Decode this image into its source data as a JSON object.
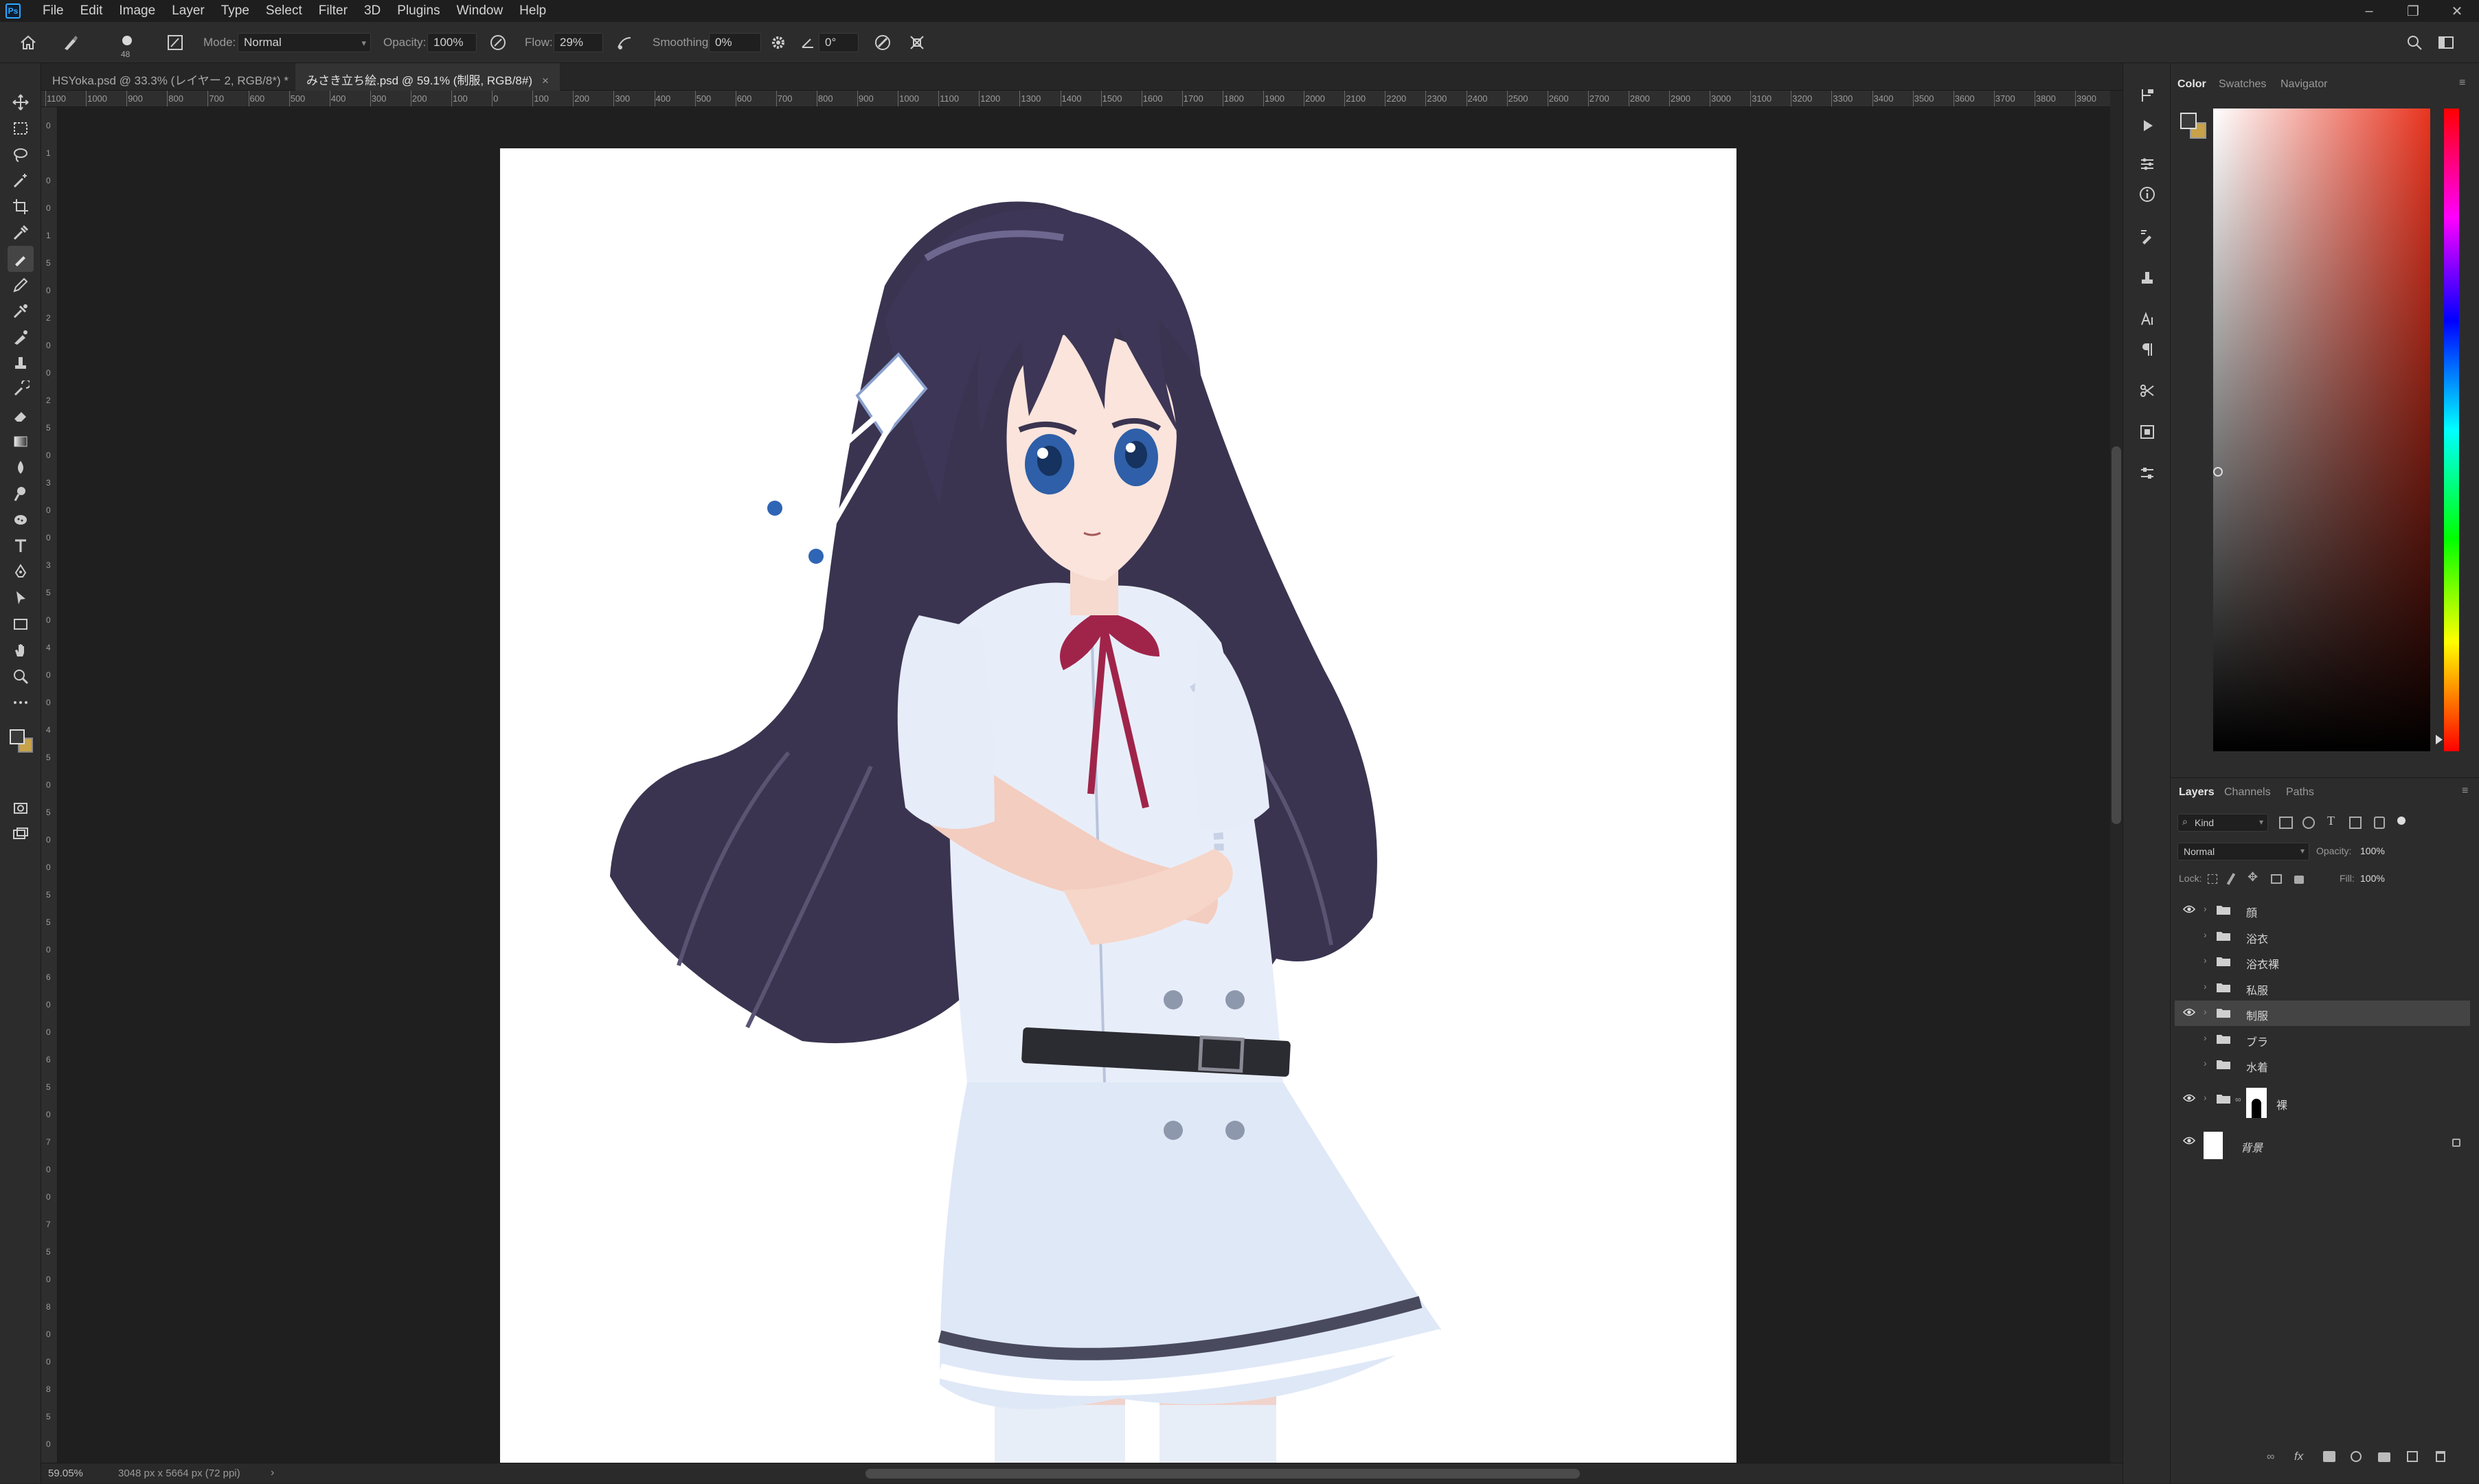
{
  "app": {
    "logo": "Ps"
  },
  "menu": [
    "File",
    "Edit",
    "Image",
    "Layer",
    "Type",
    "Select",
    "Filter",
    "3D",
    "Plugins",
    "Window",
    "Help"
  ],
  "window_controls": [
    "–",
    "❐",
    "✕"
  ],
  "options_bar": {
    "brush_size": "48",
    "mode_label": "Mode:",
    "mode_value": "Normal",
    "opacity_label": "Opacity:",
    "opacity_value": "100%",
    "flow_label": "Flow:",
    "flow_value": "29%",
    "smoothing_label": "Smoothing:",
    "smoothing_value": "0%",
    "angle_value": "0°"
  },
  "tabs": [
    {
      "label": "HSYoka.psd @ 33.3% (レイヤー 2, RGB/8*) *",
      "active": false
    },
    {
      "label": "みさき立ち絵.psd @ 59.1% (制服, RGB/8#)",
      "active": true
    }
  ],
  "ruler_h": [
    "1100",
    "1000",
    "900",
    "800",
    "700",
    "600",
    "500",
    "400",
    "300",
    "200",
    "100",
    "0",
    "100",
    "200",
    "300",
    "400",
    "500",
    "600",
    "700",
    "800",
    "900",
    "1000",
    "1100",
    "1200",
    "1300",
    "1400",
    "1500",
    "1600",
    "1700",
    "1800",
    "1900",
    "2000",
    "2100",
    "2200",
    "2300",
    "2400",
    "2500",
    "2600",
    "2700",
    "2800",
    "2900",
    "3000",
    "3100",
    "3200",
    "3300",
    "3400",
    "3500",
    "3600",
    "3700",
    "3800",
    "3900"
  ],
  "ruler_v": [
    "0",
    "1",
    "0",
    "0",
    "1",
    "5",
    "0",
    "2",
    "0",
    "0",
    "2",
    "5",
    "0",
    "3",
    "0",
    "0",
    "3",
    "5",
    "0",
    "4",
    "0",
    "0",
    "4",
    "5",
    "0",
    "5",
    "0",
    "0",
    "5",
    "5",
    "0",
    "6",
    "0",
    "0",
    "6",
    "5",
    "0",
    "7",
    "0",
    "0",
    "7",
    "5",
    "0",
    "8",
    "0",
    "0",
    "8",
    "5",
    "0"
  ],
  "status": {
    "zoom": "59.05%",
    "doc_info": "3048 px x 5664 px (72 ppi)",
    "arrow": "›"
  },
  "color_panel": {
    "tabs": [
      "Color",
      "Swatches",
      "Navigator"
    ],
    "active_tab": "Color",
    "foreground": "#3a3a3a",
    "background": "#c8a24a"
  },
  "layers_panel": {
    "tabs": [
      "Layers",
      "Channels",
      "Paths"
    ],
    "filter_label": "Kind",
    "blend_mode": "Normal",
    "opacity_label": "Opacity:",
    "opacity_value": "100%",
    "lock_label": "Lock:",
    "fill_label": "Fill:",
    "fill_value": "100%",
    "layers": [
      {
        "name": "顔",
        "visible": true,
        "type": "group",
        "selected": false
      },
      {
        "name": "浴衣",
        "visible": false,
        "type": "group",
        "selected": false
      },
      {
        "name": "浴衣裸",
        "visible": false,
        "type": "group",
        "selected": false
      },
      {
        "name": "私服",
        "visible": false,
        "type": "group",
        "selected": false
      },
      {
        "name": "制服",
        "visible": true,
        "type": "group",
        "selected": true
      },
      {
        "name": "ブラ",
        "visible": false,
        "type": "group",
        "selected": false
      },
      {
        "name": "水着",
        "visible": false,
        "type": "group",
        "selected": false
      },
      {
        "name": "裸",
        "visible": true,
        "type": "group-mask",
        "selected": false
      },
      {
        "name": "背景",
        "visible": true,
        "type": "background",
        "selected": false
      }
    ]
  },
  "colors": {
    "accent": "#31a8ff",
    "panel_bg": "#2c2c2c",
    "canvas_bg": "#1f1f1f"
  }
}
